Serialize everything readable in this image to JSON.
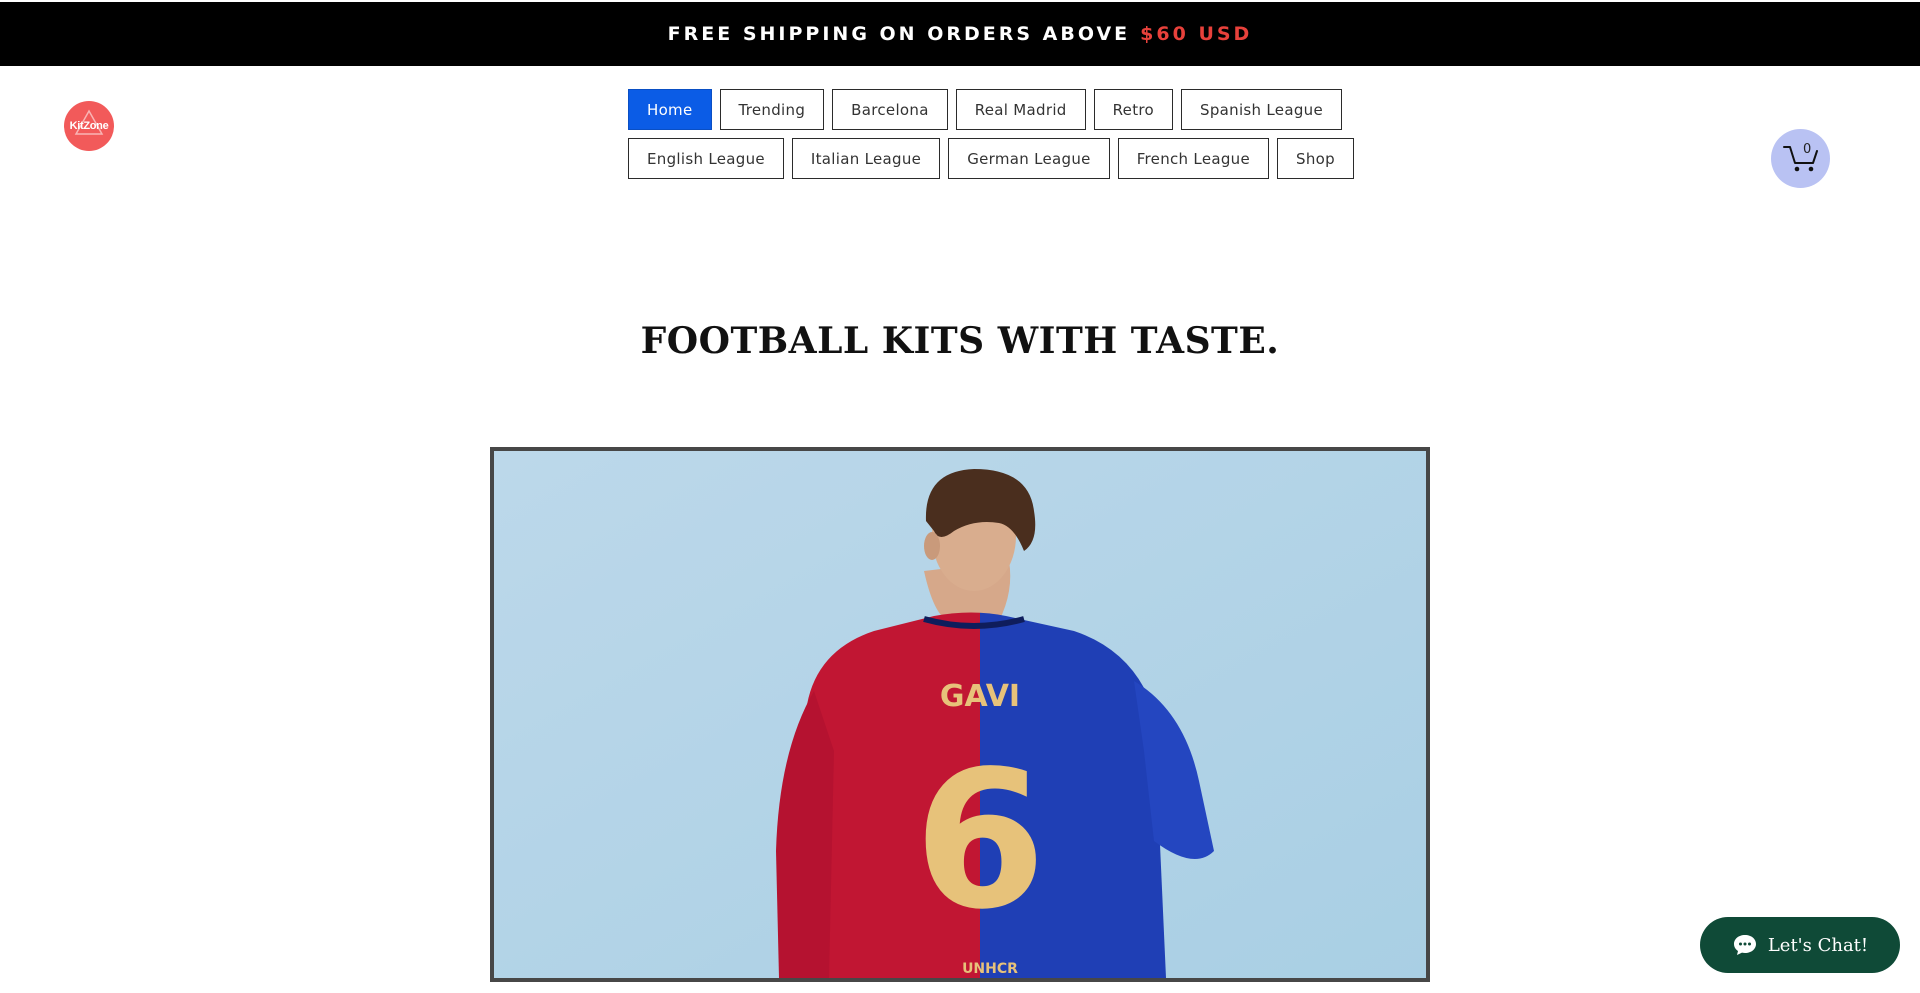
{
  "promo": {
    "text": "FREE SHIPPING ON ORDERS ABOVE",
    "price": "$60 USD"
  },
  "logo": {
    "text": "KitZone"
  },
  "nav": {
    "row1": [
      {
        "label": "Home",
        "active": true
      },
      {
        "label": "Trending"
      },
      {
        "label": "Barcelona"
      },
      {
        "label": "Real Madrid"
      },
      {
        "label": "Retro"
      },
      {
        "label": "Spanish League"
      }
    ],
    "row2": [
      {
        "label": "English League"
      },
      {
        "label": "Italian League"
      },
      {
        "label": "German League"
      },
      {
        "label": "French League"
      },
      {
        "label": "Shop"
      }
    ]
  },
  "cart": {
    "count": "0",
    "icon": "cart-icon"
  },
  "hero": {
    "headline": "FOOTBALL KITS WITH TASTE.",
    "jersey_name": "GAVI",
    "jersey_number": "6",
    "sponsor": "UNHCR"
  },
  "chat": {
    "label": "Let's Chat!",
    "icon": "chat-bubble-icon"
  },
  "colors": {
    "accent_red": "#e8413b",
    "nav_active": "#0b5ce6",
    "chat_bg": "#0f4a37",
    "cart_bg": "#b9c2f3",
    "logo_bg": "#f25a5a"
  }
}
